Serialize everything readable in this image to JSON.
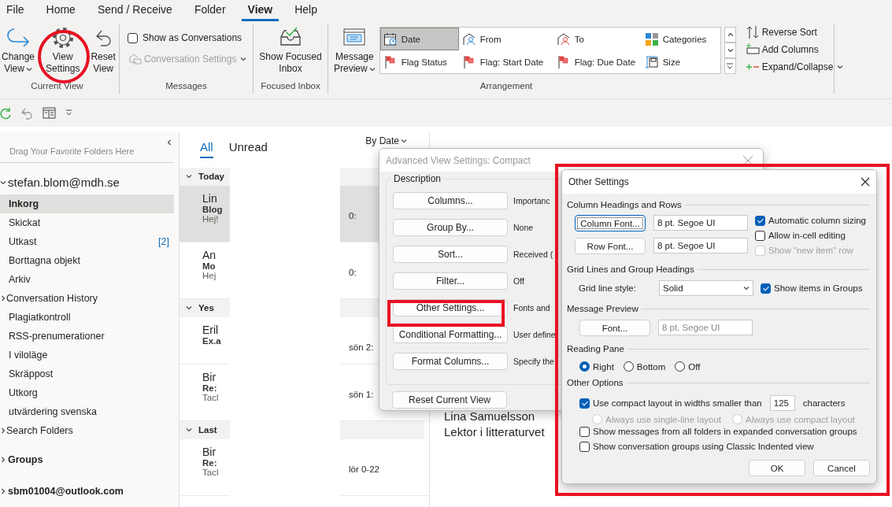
{
  "ribbon_tabs": [
    {
      "label": "File",
      "selected": false
    },
    {
      "label": "Home",
      "selected": false
    },
    {
      "label": "Send / Receive",
      "selected": false
    },
    {
      "label": "Folder",
      "selected": false
    },
    {
      "label": "View",
      "selected": true
    },
    {
      "label": "Help",
      "selected": false
    }
  ],
  "ribbon": {
    "current_view": {
      "label": "Current View",
      "buttons": [
        {
          "kind": "change",
          "lines": [
            "Change",
            "View"
          ],
          "dropdown": true
        },
        {
          "kind": "settings",
          "lines": [
            "View",
            "Settings"
          ],
          "dropdown": false
        },
        {
          "kind": "reset",
          "lines": [
            "Reset",
            "View"
          ],
          "dropdown": false
        }
      ]
    },
    "messages": {
      "label": "Messages",
      "show_as_conversations": {
        "label": "Show as Conversations",
        "checked": false
      },
      "conversation_settings": {
        "label": "Conversation Settings",
        "disabled": true
      }
    },
    "focused_inbox": {
      "label": "Focused Inbox",
      "button": [
        "Show Focused",
        "Inbox"
      ]
    },
    "arrangement": {
      "label": "Arrangement",
      "message_preview": [
        "Message",
        "Preview"
      ],
      "gallery": [
        {
          "label": "Date",
          "kind": "date",
          "selected": true
        },
        {
          "label": "From",
          "kind": "from",
          "selected": false
        },
        {
          "label": "To",
          "kind": "to",
          "selected": false
        },
        {
          "label": "Categories",
          "kind": "categories",
          "selected": false
        },
        {
          "label": "Flag Status",
          "kind": "flag",
          "selected": false
        },
        {
          "label": "Flag: Start Date",
          "kind": "flag",
          "selected": false
        },
        {
          "label": "Flag: Due Date",
          "kind": "flag",
          "selected": false
        },
        {
          "label": "Size",
          "kind": "size",
          "selected": false
        }
      ],
      "commands": [
        {
          "label": "Reverse Sort",
          "kind": "sort",
          "dropdown": false
        },
        {
          "label": "Add Columns",
          "kind": "columns",
          "dropdown": false
        },
        {
          "label": "Expand/Collapse",
          "kind": "expand",
          "dropdown": true
        }
      ]
    }
  },
  "folder_pane": {
    "hint": "Drag Your Favorite Folders Here",
    "accounts": [
      {
        "name": "stefan.blom@mdh.se",
        "expanded": true,
        "children": [
          {
            "label": "Inkorg",
            "selected": true,
            "kind": "folder"
          },
          {
            "label": "Skickat",
            "selected": false,
            "kind": "folder"
          },
          {
            "label": "Utkast",
            "selected": false,
            "kind": "folder",
            "count": "[2]"
          },
          {
            "label": "Borttagna objekt",
            "selected": false,
            "kind": "folder"
          },
          {
            "label": "Arkiv",
            "selected": false,
            "kind": "folder"
          },
          {
            "label": "Conversation History",
            "selected": false,
            "kind": "parent"
          },
          {
            "label": "Plagiatkontroll",
            "selected": false,
            "kind": "folder"
          },
          {
            "label": "RSS-prenumerationer",
            "selected": false,
            "kind": "folder"
          },
          {
            "label": "I viloläge",
            "selected": false,
            "kind": "folder"
          },
          {
            "label": "Skräppost",
            "selected": false,
            "kind": "folder"
          },
          {
            "label": "Utkorg",
            "selected": false,
            "kind": "folder"
          },
          {
            "label": "utvärdering svenska",
            "selected": false,
            "kind": "folder"
          },
          {
            "label": "Search Folders",
            "selected": false,
            "kind": "parent"
          }
        ]
      },
      {
        "name": "Groups",
        "expanded": false
      },
      {
        "name": "sbm01004@outlook.com",
        "expanded": false
      }
    ]
  },
  "message_list": {
    "filters": [
      {
        "label": "All",
        "selected": true
      },
      {
        "label": "Unread",
        "selected": false
      }
    ],
    "sort": "By Date",
    "groups": [
      {
        "label": "Today",
        "messages": [
          {
            "sender": "Lin",
            "subject": "Blog",
            "preview": "Hej!",
            "time": "0:",
            "selected": true
          },
          {
            "sender": "An",
            "subject": "Mo",
            "preview": "Hej",
            "time": "0:",
            "selected": false
          }
        ]
      },
      {
        "label": "Yes",
        "messages": [
          {
            "sender": "Eril",
            "subject": "Ex.a",
            "time": "sön 2:",
            "selected": false
          },
          {
            "sender": "Bir",
            "subject": "Re:",
            "preview": "Tacl",
            "time": "sön 1:",
            "selected": false
          }
        ]
      },
      {
        "label": "Last",
        "messages": [
          {
            "sender": "Bir",
            "subject": "Re:",
            "preview": "Tacl",
            "time": "lör 0-22",
            "selected": false
          }
        ]
      }
    ]
  },
  "reading_pane": {
    "lines": [
      "Lina Samuelsson",
      "Lektor i litteraturvet"
    ]
  },
  "advanced_dialog": {
    "title": "Advanced View Settings: Compact",
    "group": "Description",
    "rows": [
      {
        "button": "Columns...",
        "description": "Importanc"
      },
      {
        "button": "Group By...",
        "description": "None"
      },
      {
        "button": "Sort...",
        "description": "Received ("
      },
      {
        "button": "Filter...",
        "description": "Off"
      },
      {
        "button": "Other Settings...",
        "description": "Fonts and"
      },
      {
        "button": "Conditional Formatting...",
        "description": "User define"
      },
      {
        "button": "Format Columns...",
        "description": "Specify the"
      }
    ],
    "reset": "Reset Current View"
  },
  "other_settings": {
    "title": "Other Settings",
    "column_headings": {
      "heading": "Column Headings and Rows",
      "fonts": [
        {
          "button": "Column Font...",
          "value": "8 pt. Segoe UI",
          "focused": true
        },
        {
          "button": "Row Font...",
          "value": "8 pt. Segoe UI",
          "focused": false
        }
      ],
      "options": [
        {
          "label": "Automatic column sizing",
          "checked": true,
          "disabled": false
        },
        {
          "label": "Allow in-cell editing",
          "checked": false,
          "disabled": false
        },
        {
          "label": "Show \"new item\" row",
          "checked": false,
          "disabled": true
        }
      ]
    },
    "grid_lines": {
      "heading": "Grid Lines and Group Headings",
      "label": "Grid line style:",
      "value": "Solid",
      "option": {
        "label": "Show items in Groups",
        "checked": true
      }
    },
    "message_preview": {
      "heading": "Message Preview",
      "button": "Font...",
      "value": "8 pt. Segoe UI",
      "disabled": true
    },
    "reading_pane": {
      "heading": "Reading Pane",
      "options": [
        {
          "label": "Right",
          "selected": true
        },
        {
          "label": "Bottom",
          "selected": false
        },
        {
          "label": "Off",
          "selected": false
        }
      ]
    },
    "other_options": {
      "heading": "Other Options",
      "compact": {
        "label": "Use compact layout in widths smaller than",
        "checked": true,
        "value": "125",
        "suffix": "characters"
      },
      "layouts": [
        {
          "label": "Always use single-line layout",
          "selected": false,
          "disabled": true
        },
        {
          "label": "Always use compact layout",
          "selected": false,
          "disabled": true
        }
      ],
      "options": [
        {
          "label": "Show messages from all folders in expanded conversation groups",
          "checked": false
        },
        {
          "label": "Show conversation groups using Classic Indented view",
          "checked": false
        }
      ]
    },
    "buttons": [
      "OK",
      "Cancel"
    ]
  }
}
